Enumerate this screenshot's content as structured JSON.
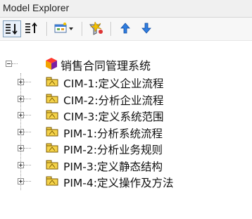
{
  "window": {
    "title": "Model Explorer"
  },
  "toolbar": {
    "buttons": [
      {
        "name": "sort-ascending-icon"
      },
      {
        "name": "sort-descending-icon"
      },
      {
        "name": "new-diagram-dropdown-icon"
      },
      {
        "name": "filter-icon"
      },
      {
        "name": "move-up-icon"
      },
      {
        "name": "move-down-icon"
      }
    ]
  },
  "tree": {
    "root": {
      "label": "销售合同管理系统",
      "expanded": true
    },
    "children": [
      {
        "label": "CIM-1:定义企业流程"
      },
      {
        "label": "CIM-2:分析企业流程"
      },
      {
        "label": "CIM-3:定义系统范围"
      },
      {
        "label": "PIM-1:分析系统流程"
      },
      {
        "label": "PIM-2:分析业务规则"
      },
      {
        "label": "PIM-3:定义静态结构"
      },
      {
        "label": "PIM-4:定义操作及方法"
      }
    ]
  },
  "colors": {
    "package_fill": "#f5d34a",
    "package_border": "#7a5a00",
    "arrow": "#1f6fd6"
  }
}
